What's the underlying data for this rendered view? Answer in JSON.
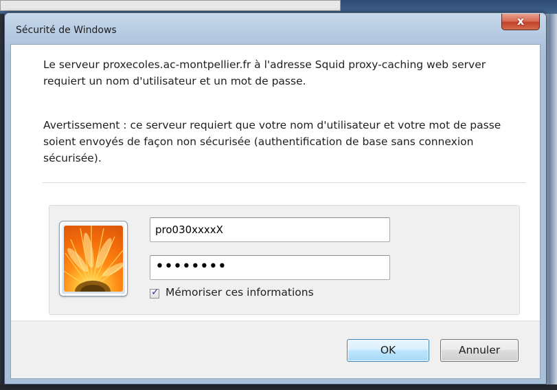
{
  "window": {
    "title": "Sécurité de Windows",
    "close_glyph": "x"
  },
  "message": {
    "line1": "Le serveur proxecoles.ac-montpellier.fr à l'adresse Squid proxy-caching web server requiert un nom d'utilisateur et un mot de passe.",
    "warning": "Avertissement : ce serveur requiert que votre nom d'utilisateur et votre mot de passe soient envoyés de façon non sécurisée (authentification de base sans connexion sécurisée)."
  },
  "credentials": {
    "username": "pro030xxxxX",
    "password_mask": "••••••••",
    "remember_label": "Mémoriser ces informations",
    "remember_checked": true
  },
  "buttons": {
    "ok_label": "OK",
    "cancel_label": "Annuler"
  },
  "icons": {
    "avatar": "flower-user-tile-icon",
    "close": "close-icon",
    "check": "checkmark-icon"
  },
  "colors": {
    "close_button": "#c3422a",
    "ok_border": "#3c7fb1",
    "frame": "#b6cbe2"
  }
}
